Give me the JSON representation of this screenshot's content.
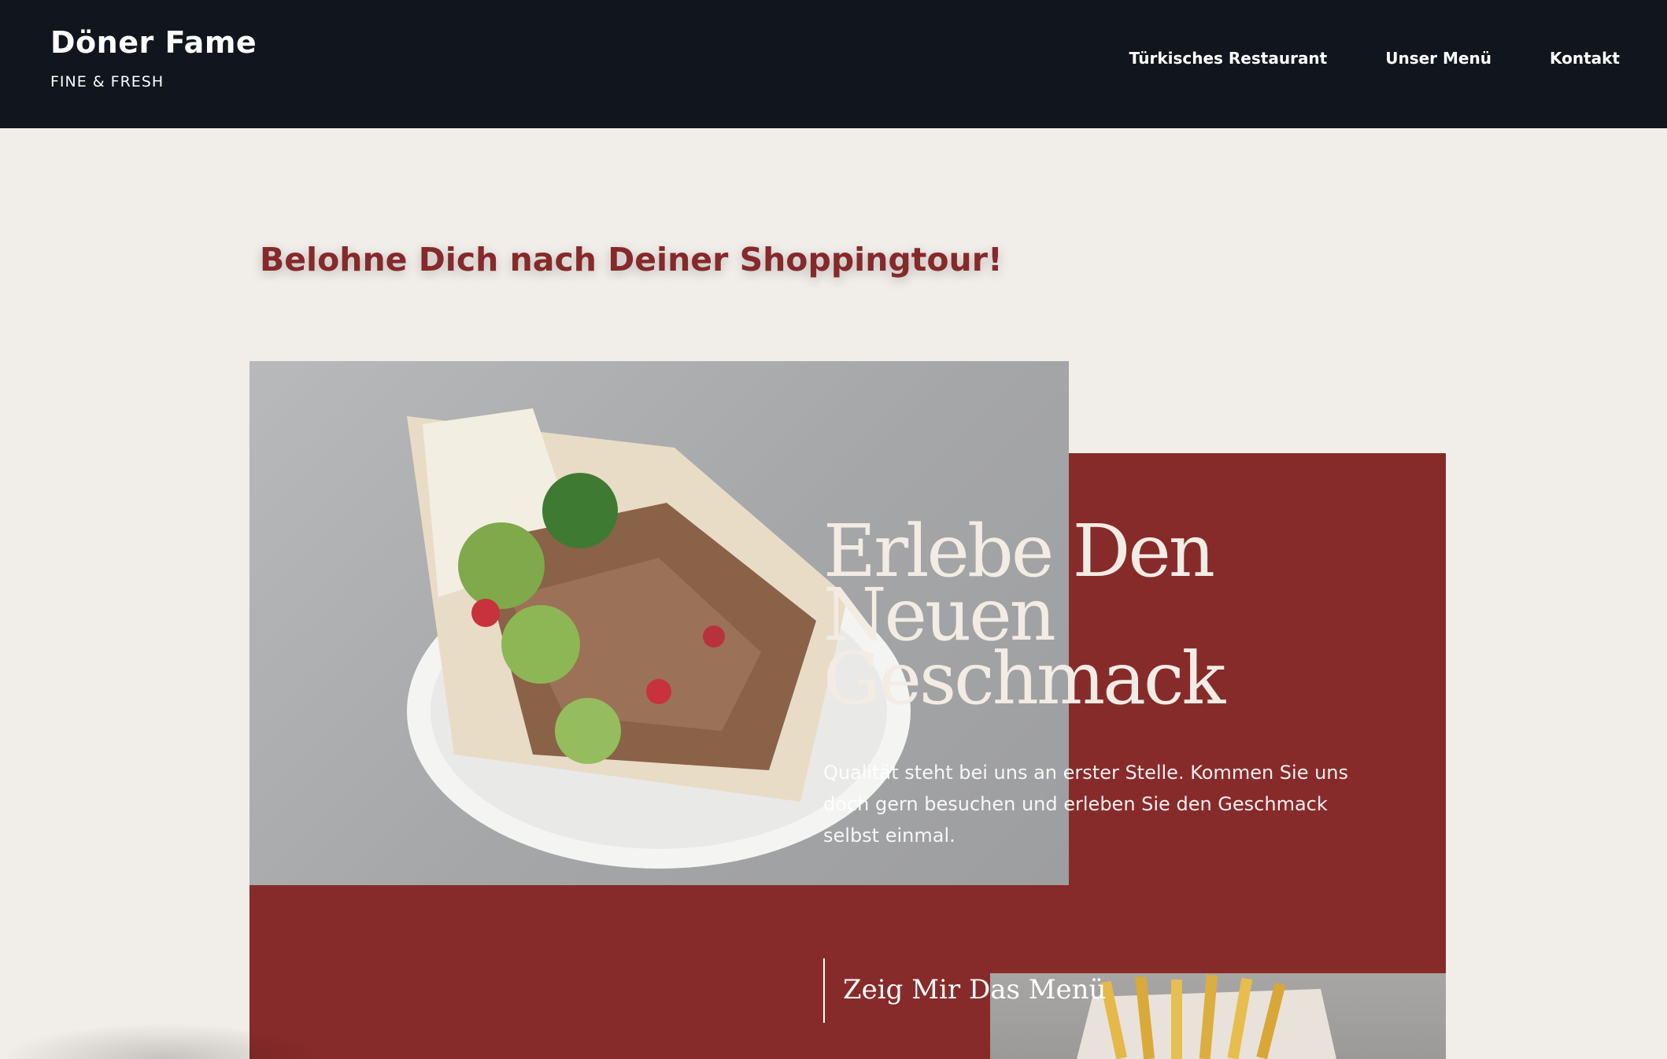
{
  "header": {
    "brand_title": "Döner Fame",
    "brand_subtitle": "FINE & FRESH",
    "nav": [
      {
        "label": "Türkisches Restaurant"
      },
      {
        "label": "Unser Menü"
      },
      {
        "label": "Kontakt"
      }
    ]
  },
  "promo": {
    "headline": "Belohne Dich nach Deiner Shoppingtour!"
  },
  "hero": {
    "heading_lines": [
      "Erlebe Den",
      "Neuen",
      "Geschmack"
    ],
    "text": "Qualität steht bei uns an erster Stelle. Kommen Sie uns doch gern besuchen und erleben Sie den Geschmack selbst einmal.",
    "cta_label": "Zeig Mir Das Menü"
  },
  "colors": {
    "header_bg": "#11151e",
    "page_bg": "#f1ede9",
    "accent_red": "#872b2a",
    "promo_text": "#85292a"
  }
}
